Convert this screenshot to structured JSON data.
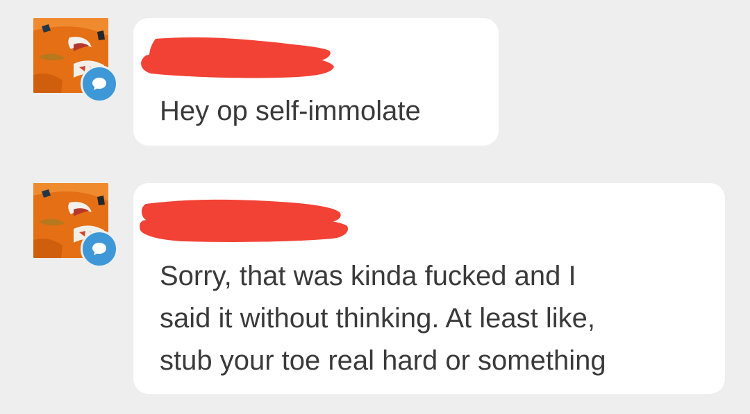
{
  "messages": [
    {
      "author": "",
      "text": "Hey op self-immolate",
      "name_redacted": true
    },
    {
      "author": "",
      "text": "Sorry, that was kinda fucked and I\nsaid it without thinking. At least like,\nstub your toe real hard or something",
      "name_redacted": true
    }
  ],
  "icons": {
    "avatar": "user-avatar-icon",
    "badge": "chat-bubble-icon"
  },
  "colors": {
    "background": "#eeeeee",
    "bubble": "#ffffff",
    "text": "#3a3a3a",
    "redaction": "#f24235",
    "badge": "#3e97d6",
    "avatar": "#e46f14"
  }
}
